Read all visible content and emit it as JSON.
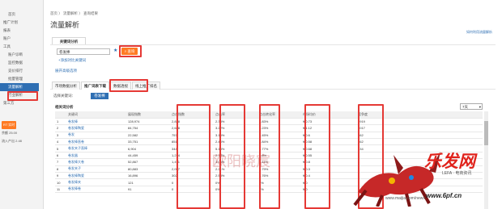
{
  "sidebar": {
    "items": [
      {
        "label": "首页",
        "kind": "item"
      },
      {
        "label": "推广计划",
        "kind": "group"
      },
      {
        "label": "报表",
        "kind": "group"
      },
      {
        "label": "账户",
        "kind": "group"
      },
      {
        "label": "工具",
        "kind": "group"
      },
      {
        "label": "账户诊断",
        "kind": "item"
      },
      {
        "label": "监控数据",
        "kind": "item"
      },
      {
        "label": "竞价排行",
        "kind": "item"
      },
      {
        "label": "批量管理",
        "kind": "item"
      },
      {
        "label": "流量解析",
        "kind": "active"
      },
      {
        "label": "行业解析",
        "kind": "item"
      },
      {
        "label": "第三方",
        "kind": "group"
      }
    ],
    "realtime_badge": "RT 实时",
    "status_rows": [
      "余额 25.00",
      "流入产出 2.48"
    ]
  },
  "breadcrumb": "首页 〉 流量解析 〉 查询结果",
  "page_title": "流量解析",
  "top_link": "如何利用流量解析",
  "keyword_panel": {
    "tab_label": "关键词分析",
    "input_value": "卷发棒",
    "query_button": "查询",
    "add_link": "+添加对比关键词",
    "advanced_link": "展开高级选项"
  },
  "tabs": [
    "市场数据分析",
    "推广词表下载",
    "数据透视",
    "线上推广排名"
  ],
  "active_tab": 1,
  "filter": {
    "label": "选择关键词：",
    "button": "卷发棒"
  },
  "result_title": "相关词分析",
  "range_select": "7天",
  "table": {
    "headers": [
      "",
      "关键词",
      "展现指数",
      "",
      "点击指数",
      "",
      "点击率",
      "",
      "点击转化率",
      "",
      "市场均价",
      "",
      "竞争度"
    ],
    "rows": [
      [
        "1",
        "卷发棒",
        "128,974",
        "",
        "2,838",
        "",
        "2.33%",
        "",
        "4.83%",
        "",
        "¥ 0.73",
        "",
        "1919"
      ],
      [
        "2",
        "卷发棒陶瓷",
        "84,754",
        "",
        "2,628",
        "",
        "3.22%",
        "",
        "2.23%",
        "",
        "¥ 1.12",
        "",
        "1017"
      ],
      [
        "3",
        "卷发",
        "22,582",
        "",
        "757",
        "",
        "3.15%",
        "",
        "6.45%",
        "",
        "¥ 0.6",
        "",
        "662"
      ],
      [
        "4",
        "卷发棒直卷",
        "33,751",
        "",
        "851",
        "",
        "2.44%",
        "",
        "1.84%",
        "",
        "¥ 0.58",
        "",
        "662"
      ],
      [
        "5",
        "卷发夹子直棒",
        "6,904",
        "",
        "344",
        "",
        "5.13%",
        "",
        "8.77%",
        "",
        "¥ 0.68",
        "",
        "234"
      ],
      [
        "6",
        "卷发器",
        "44,459",
        "",
        "1,214",
        "",
        "2.72%",
        "",
        "4.8%",
        "",
        "¥ 0.55",
        "",
        "1"
      ],
      [
        "7",
        "卷发棒大卷",
        "52,867",
        "",
        "1,471",
        "",
        "3.06%",
        "",
        "3.11%",
        "",
        "¥ 0.8",
        "",
        "1"
      ],
      [
        "8",
        "卷发夹子",
        "80,883",
        "",
        "2,097",
        "",
        "2.21%",
        "",
        "3.79%",
        "",
        "¥ 0.3",
        "",
        "1"
      ],
      [
        "9",
        "卷发棒陶瓷",
        "16,896",
        "",
        "302",
        "",
        "2.58%",
        "",
        "1.76%",
        "",
        "¥ 0.4",
        "",
        "1"
      ],
      [
        "10",
        "卷发棒夹",
        "121",
        "",
        "0",
        "",
        "0%",
        "",
        "0%",
        "",
        "¥ 0",
        "",
        "1"
      ],
      [
        "11",
        "卷发棒卷",
        "91",
        "",
        "0",
        "",
        "0%",
        "",
        "0%",
        "",
        "¥ 0",
        "",
        "0"
      ]
    ]
  },
  "watermark": "欧阳晓宸",
  "brand": {
    "text": "乐发网",
    "sub": "LEFA · 电商资讯",
    "url": "www.6pf.cn",
    "site": "www.maijia.com/news"
  }
}
